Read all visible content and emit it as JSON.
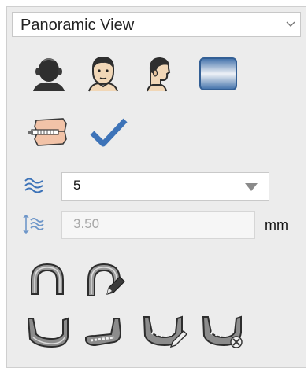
{
  "header": {
    "title": "Panoramic View"
  },
  "view_buttons": [
    {
      "icon": "head-top-view-icon"
    },
    {
      "icon": "head-front-view-icon"
    },
    {
      "icon": "head-side-view-icon"
    },
    {
      "icon": "gradient-slab-icon"
    }
  ],
  "tools": [
    {
      "icon": "jaw-model-icon"
    },
    {
      "icon": "checkmark-icon"
    }
  ],
  "layer_select": {
    "icon": "waves-icon",
    "value": "5"
  },
  "thickness": {
    "icon": "thickness-waves-icon",
    "value": "3.50",
    "unit": "mm"
  },
  "arch_buttons": [
    {
      "icon": "arch-curve-icon"
    },
    {
      "icon": "arch-edit-icon"
    }
  ],
  "mandible_buttons": [
    {
      "icon": "mandible-icon"
    },
    {
      "icon": "mandible-nerve-icon"
    },
    {
      "icon": "mandible-edit-icon"
    },
    {
      "icon": "mandible-delete-icon"
    }
  ],
  "colors": {
    "accent_blue": "#3d73b8",
    "panel_bg": "#ececec",
    "disabled_text": "#a7a7a7"
  }
}
